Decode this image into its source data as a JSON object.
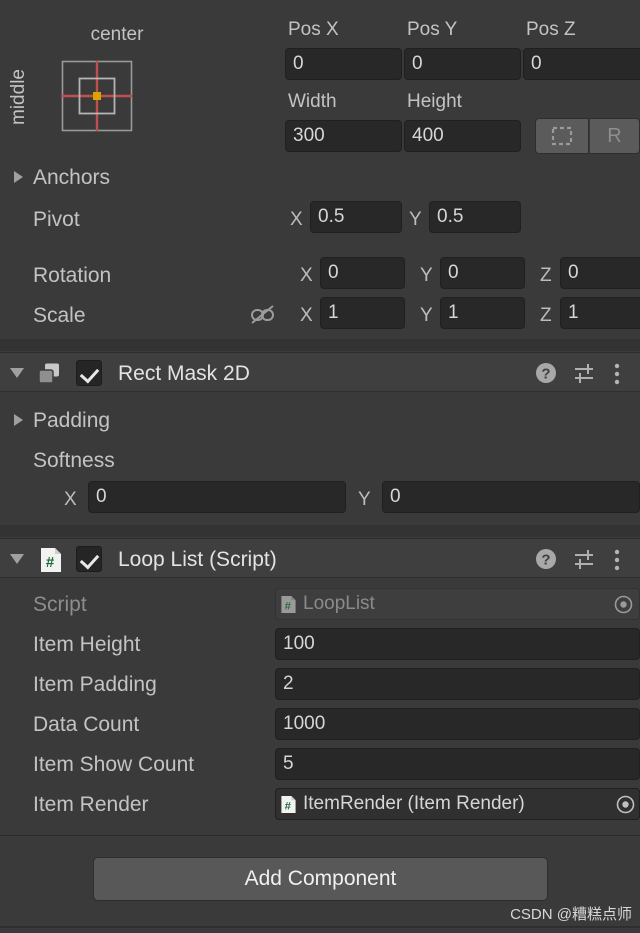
{
  "rect_transform": {
    "anchor_preset": {
      "horizontal_label": "center",
      "vertical_label": "middle",
      "crosshair_color": "#c0504d",
      "pivot_dot_color": "#d9a300"
    },
    "position": {
      "pos_x_label": "Pos X",
      "pos_x_value": "0",
      "pos_y_label": "Pos Y",
      "pos_y_value": "0",
      "pos_z_label": "Pos Z",
      "pos_z_value": "0"
    },
    "size": {
      "width_label": "Width",
      "width_value": "300",
      "height_label": "Height",
      "height_value": "400"
    },
    "mode_buttons": {
      "blueprint_label": "",
      "raw_label": "R"
    },
    "anchors_label": "Anchors",
    "pivot": {
      "label": "Pivot",
      "x_axis": "X",
      "x_value": "0.5",
      "y_axis": "Y",
      "y_value": "0.5"
    },
    "rotation": {
      "label": "Rotation",
      "x_axis": "X",
      "x_value": "0",
      "y_axis": "Y",
      "y_value": "0",
      "z_axis": "Z",
      "z_value": "0"
    },
    "scale": {
      "label": "Scale",
      "x_axis": "X",
      "x_value": "1",
      "y_axis": "Y",
      "y_value": "1",
      "z_axis": "Z",
      "z_value": "1"
    }
  },
  "rect_mask": {
    "title": "Rect Mask 2D",
    "enabled": true,
    "padding_label": "Padding",
    "softness_label": "Softness",
    "softness_x_axis": "X",
    "softness_x_value": "0",
    "softness_y_axis": "Y",
    "softness_y_value": "0"
  },
  "loop_list": {
    "title": "Loop List (Script)",
    "enabled": true,
    "fields": {
      "script_label": "Script",
      "script_value": "LoopList",
      "item_height_label": "Item Height",
      "item_height_value": "100",
      "item_padding_label": "Item Padding",
      "item_padding_value": "2",
      "data_count_label": "Data Count",
      "data_count_value": "1000",
      "item_show_count_label": "Item Show Count",
      "item_show_count_value": "5",
      "item_render_label": "Item Render",
      "item_render_value": "ItemRender (Item Render)"
    }
  },
  "footer": {
    "add_component_label": "Add Component",
    "watermark": "CSDN @糟糕点师"
  }
}
